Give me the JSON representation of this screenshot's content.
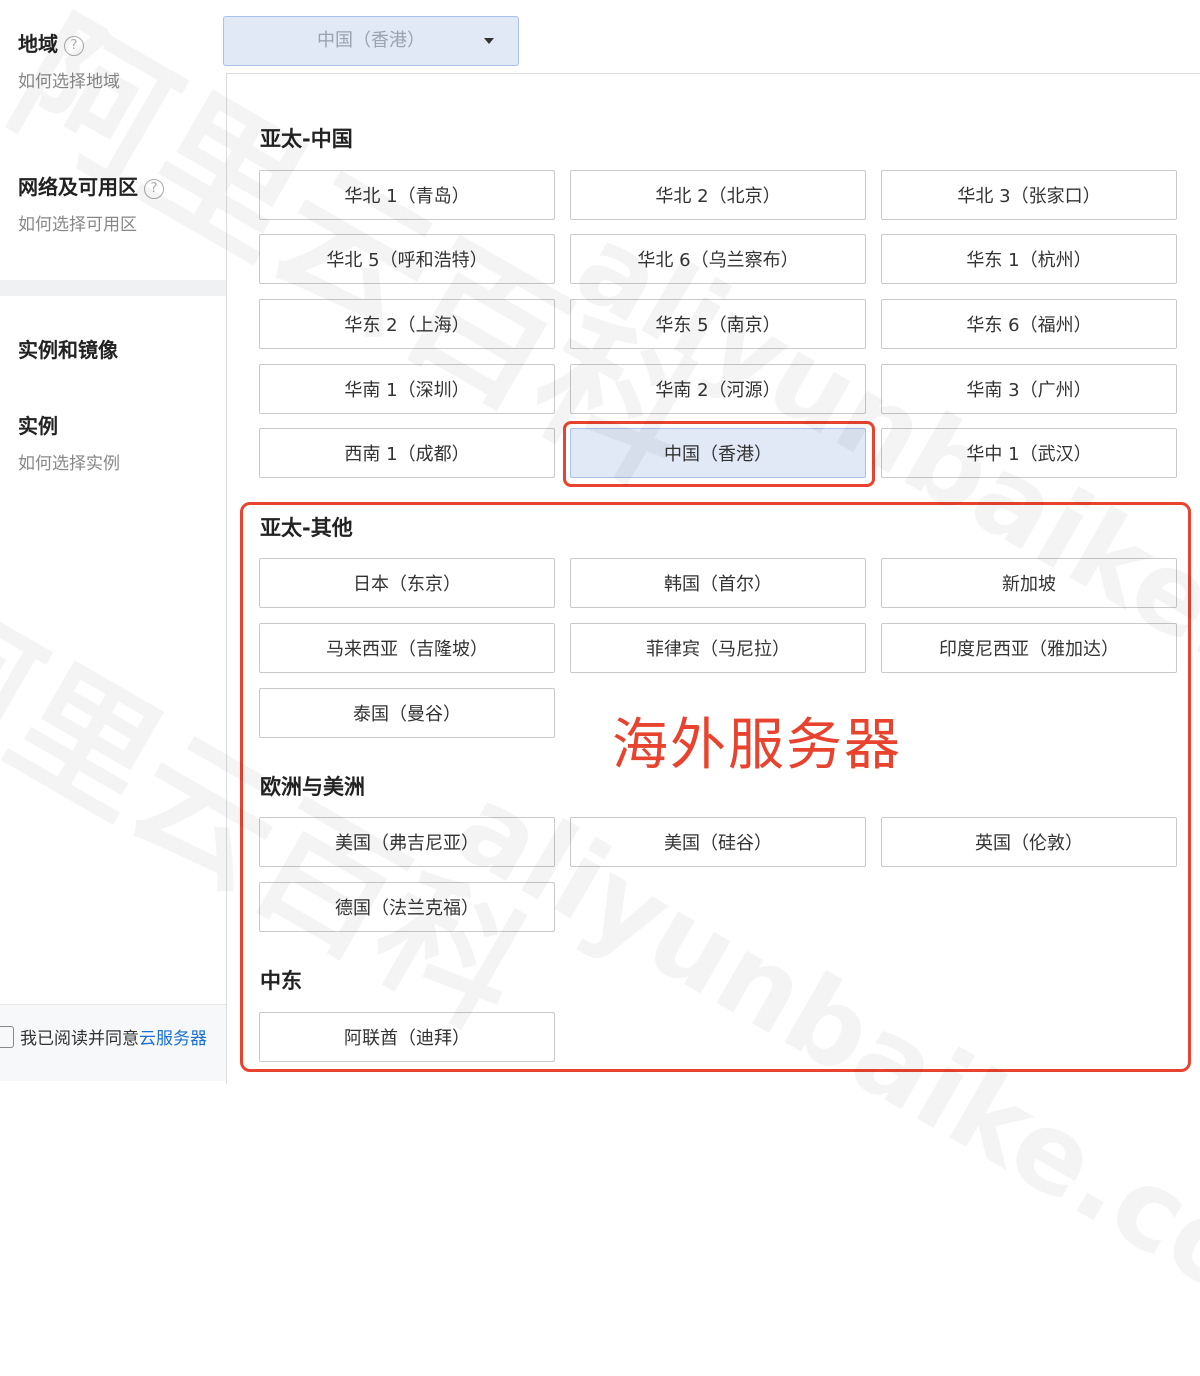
{
  "left": {
    "region": {
      "title": "地域",
      "help": "?",
      "sub": "如何选择地域"
    },
    "network": {
      "title": "网络及可用区",
      "help": "?",
      "sub": "如何选择可用区"
    },
    "instance_image": {
      "title": "实例和镜像"
    },
    "instance": {
      "title": "实例",
      "sub": "如何选择实例"
    },
    "agree_text": "我已阅读并同意",
    "agree_link": "云服务器"
  },
  "select": {
    "value": "中国（香港）"
  },
  "groups": {
    "apac_china": {
      "title": "亚太-中国",
      "items": [
        "华北 1（青岛）",
        "华北 2（北京）",
        "华北 3（张家口）",
        "华北 5（呼和浩特）",
        "华北 6（乌兰察布）",
        "华东 1（杭州）",
        "华东 2（上海）",
        "华东 5（南京）",
        "华东 6（福州）",
        "华南 1（深圳）",
        "华南 2（河源）",
        "华南 3（广州）",
        "西南 1（成都）",
        "中国（香港）",
        "华中 1（武汉）"
      ]
    },
    "apac_other": {
      "title": "亚太-其他",
      "items": [
        "日本（东京）",
        "韩国（首尔）",
        "新加坡",
        "马来西亚（吉隆坡）",
        "菲律宾（马尼拉）",
        "印度尼西亚（雅加达）",
        "泰国（曼谷）"
      ]
    },
    "europe_americas": {
      "title": "欧洲与美洲",
      "items": [
        "美国（弗吉尼亚）",
        "美国（硅谷）",
        "英国（伦敦）",
        "德国（法兰克福）"
      ]
    },
    "middle_east": {
      "title": "中东",
      "items": [
        "阿联酋（迪拜）"
      ]
    }
  },
  "annotation": "海外服务器",
  "watermark": {
    "cn": "阿里云百科",
    "en": "aliyunbaike.com"
  },
  "colors": {
    "accent": "#e8432e",
    "selected_bg": "#e1e8f6",
    "link": "#1a6fd4"
  }
}
